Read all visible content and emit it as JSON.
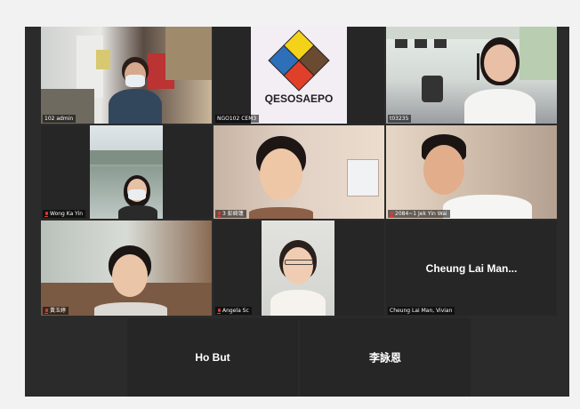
{
  "participants": [
    {
      "name": "102 admin",
      "muted": false
    },
    {
      "name": "NGO102 CEM3",
      "muted": false
    },
    {
      "name": "t03235",
      "muted": false
    },
    {
      "name": "Wong Ka Yin",
      "muted": true
    },
    {
      "name": "3 彭綺蓮",
      "muted": true
    },
    {
      "name": "2084~1 Jek Yin Wai",
      "muted": true
    },
    {
      "name": "黃玉婷",
      "muted": true
    },
    {
      "name": "Angela Sc",
      "muted": true
    },
    {
      "name": "Cheung Lai Man, Vivian",
      "muted": false
    },
    {
      "name": "Ho But",
      "muted": false
    },
    {
      "name": "李詠恩",
      "muted": false
    }
  ],
  "logo_text": "QESOSAEPO",
  "tile_display_names": {
    "cheung": "Cheung Lai Man...",
    "hobut": "Ho But",
    "lee": "李詠恩"
  },
  "colors": {
    "active_border": "#7cc63e",
    "muted_mic": "#e03b3b",
    "gallery_bg": "#2b2b2b"
  }
}
